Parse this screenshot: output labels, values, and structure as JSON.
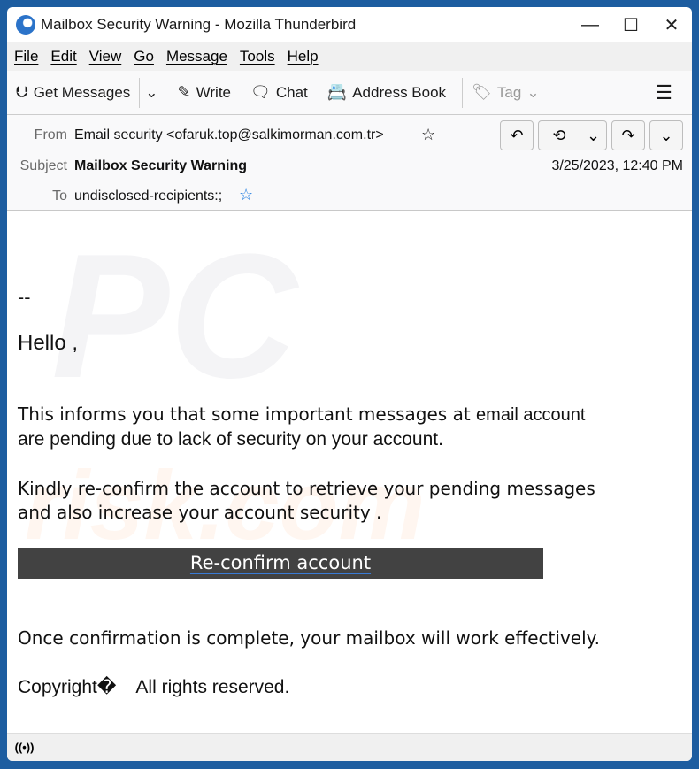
{
  "window": {
    "title": "Mailbox Security Warning - Mozilla Thunderbird",
    "minimize": "—",
    "maximize": "☐",
    "close": "✕"
  },
  "menu": [
    "File",
    "Edit",
    "View",
    "Go",
    "Message",
    "Tools",
    "Help"
  ],
  "toolbar": {
    "get_messages": "Get Messages",
    "write": "Write",
    "chat": "Chat",
    "address_book": "Address Book",
    "tag": "Tag"
  },
  "header": {
    "from_label": "From",
    "from_value": "Email security <ofaruk.top@salkimorman.com.tr>",
    "subject_label": "Subject",
    "subject_value": "Mailbox Security Warning",
    "to_label": "To",
    "to_value": "undisclosed-recipients:;",
    "date": "3/25/2023, 12:40 PM"
  },
  "body": {
    "dashes": "--",
    "greeting": "Hello ,",
    "p1_line1": "This informs you that some important messages at ",
    "p1_inline": "email account",
    "p1_line2": "are pending due to lack of security on your account.",
    "p2_line1": "Kindly re-confirm the account to retrieve your pending messages",
    "p2_line2": "and also increase your account security .",
    "cta": "Re-confirm account",
    "p3": "Once confirmation is complete, your mailbox will work effectively.",
    "copyright": "Copyright�",
    "rights": "All rights reserved."
  },
  "watermark": {
    "top": "PC",
    "bottom": "risk.com"
  },
  "colors": {
    "frame": "#1d5da0",
    "cta_bg": "#424242",
    "link_underline": "#3a7bd5"
  }
}
